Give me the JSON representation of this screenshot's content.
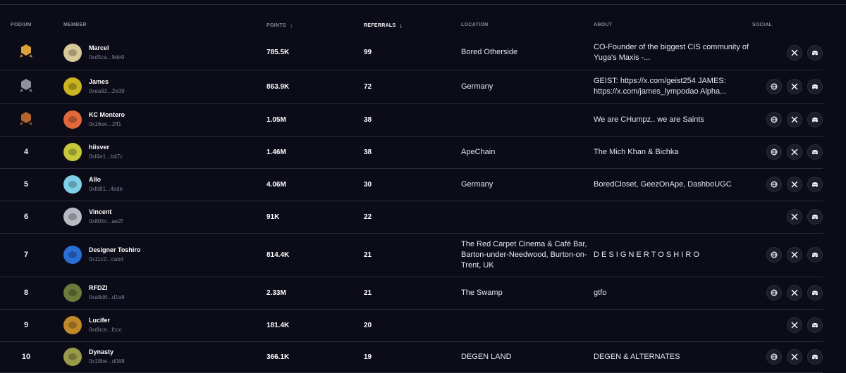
{
  "header": {
    "podium": "PODIUM",
    "member": "MEMBER",
    "points": "POINTS",
    "referrals": "REFERRALS",
    "location": "LOCATION",
    "about": "ABOUT",
    "social": "SOCIAL"
  },
  "colors": {
    "gold": "#d9a13a",
    "silver": "#8e909c",
    "bronze": "#b5652e",
    "accent": "#ffffff"
  },
  "rows": [
    {
      "rank": "1",
      "badge": "gold",
      "name": "Marcel",
      "addr": "0xd5ca...9de9",
      "points": "785.5K",
      "referrals": "99",
      "location": "Bored Otherside",
      "about": "CO-Founder of the biggest CIS community of Yuga's Maxis -...",
      "social": [
        "x-icon",
        "discord-icon"
      ],
      "avatar": "#d8c89a"
    },
    {
      "rank": "2",
      "badge": "silver",
      "name": "James",
      "addr": "0xea92...2e39",
      "points": "863.9K",
      "referrals": "72",
      "location": "Germany",
      "about": "GEIST: https://x.com/geist254 JAMES: https://x.com/james_lympodao Alpha...",
      "social": [
        "globe-icon",
        "x-icon",
        "discord-icon"
      ],
      "avatar": "#c9b51f"
    },
    {
      "rank": "3",
      "badge": "bronze",
      "name": "KC Montero",
      "addr": "0x16ee...2ff1",
      "points": "1.05M",
      "referrals": "38",
      "location": "",
      "about": "We are CHumpz.. we are Saints",
      "social": [
        "globe-icon",
        "x-icon",
        "discord-icon"
      ],
      "avatar": "#e1683a"
    },
    {
      "rank": "4",
      "badge": "",
      "name": "hiisver",
      "addr": "0xf4e1...b47c",
      "points": "1.46M",
      "referrals": "38",
      "location": "ApeChain",
      "about": "The Mich Khan & Bichka",
      "social": [
        "globe-icon",
        "x-icon",
        "discord-icon"
      ],
      "avatar": "#c7c83a"
    },
    {
      "rank": "5",
      "badge": "",
      "name": "Allo",
      "addr": "0xfd81...4cde",
      "points": "4.06M",
      "referrals": "30",
      "location": "Germany",
      "about": "BoredCloset, GeezOnApe, DashboUGC",
      "social": [
        "globe-icon",
        "x-icon",
        "discord-icon"
      ],
      "avatar": "#7fd0e6"
    },
    {
      "rank": "6",
      "badge": "",
      "name": "Vincent",
      "addr": "0x805c...ae2f",
      "points": "91K",
      "referrals": "22",
      "location": "",
      "about": "",
      "social": [
        "x-icon",
        "discord-icon"
      ],
      "avatar": "#b8b9c2"
    },
    {
      "rank": "7",
      "badge": "",
      "name": "Designer Toshiro",
      "addr": "0x11c2...cab4",
      "points": "814.4K",
      "referrals": "21",
      "location": "The Red Carpet Cinema & Café Bar, Barton-under-Needwood, Burton-on-Trent, UK",
      "about": "D E S I G N E R T O S H I R O",
      "social": [
        "globe-icon",
        "x-icon",
        "discord-icon"
      ],
      "avatar": "#2a6fd8"
    },
    {
      "rank": "8",
      "badge": "",
      "name": "RFDZI",
      "addr": "0xa8d6...d1a8",
      "points": "2.33M",
      "referrals": "21",
      "location": "The Swamp",
      "about": "gtfo",
      "social": [
        "globe-icon",
        "x-icon",
        "discord-icon"
      ],
      "avatar": "#6c7a3a"
    },
    {
      "rank": "9",
      "badge": "",
      "name": "Lucifer",
      "addr": "0xdbce...fccc",
      "points": "181.4K",
      "referrals": "20",
      "location": "",
      "about": "",
      "social": [
        "x-icon",
        "discord-icon"
      ],
      "avatar": "#c08a2a"
    },
    {
      "rank": "10",
      "badge": "",
      "name": "Dynasty",
      "addr": "0x18be...d088",
      "points": "366.1K",
      "referrals": "19",
      "location": "DEGEN LAND",
      "about": "DEGEN & ALTERNATES",
      "social": [
        "globe-icon",
        "x-icon",
        "discord-icon"
      ],
      "avatar": "#9a9a4a"
    }
  ]
}
